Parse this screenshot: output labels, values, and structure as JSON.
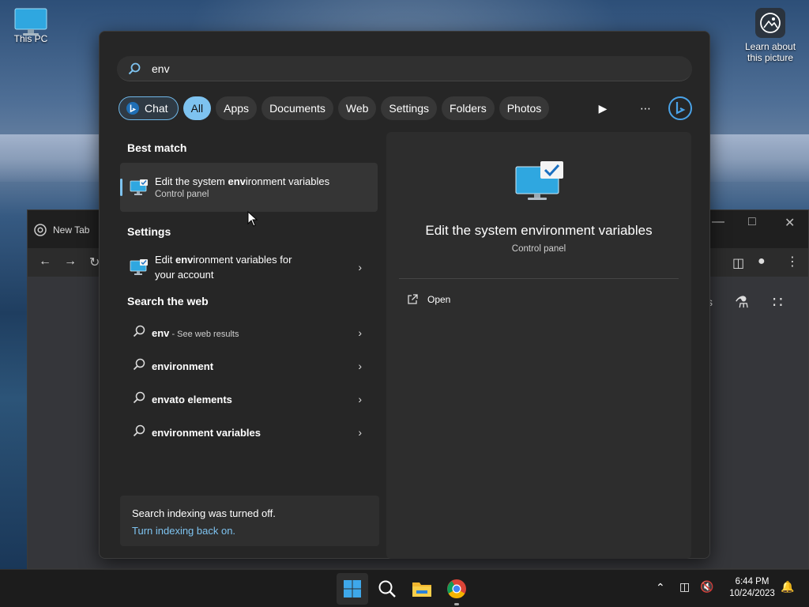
{
  "desktop": {
    "this_pc_label": "This PC",
    "learn_about_label": "Learn about this picture"
  },
  "browser": {
    "tab_title": "New Tab",
    "toolbar_partial_text": "s"
  },
  "search": {
    "query": "env",
    "filters": {
      "chat": "Chat",
      "all": "All",
      "apps": "Apps",
      "documents": "Documents",
      "web": "Web",
      "settings": "Settings",
      "folders": "Folders",
      "photos": "Photos"
    },
    "best_match": {
      "heading": "Best match",
      "title_pre": "Edit the system ",
      "title_bold": "env",
      "title_post": "ironment variables",
      "subtitle": "Control panel"
    },
    "settings_section": {
      "heading": "Settings",
      "title_pre": "Edit ",
      "title_bold": "env",
      "title_post": "ironment variables for",
      "title_line2": "your account"
    },
    "web_section": {
      "heading": "Search the web",
      "items": [
        {
          "bold": "env",
          "rest": "",
          "suffix": " - See web results"
        },
        {
          "bold": "env",
          "rest": "ironment",
          "suffix": ""
        },
        {
          "bold": "env",
          "rest": "ato elements",
          "suffix": ""
        },
        {
          "bold": "env",
          "rest": "ironment variables",
          "suffix": ""
        }
      ]
    },
    "indexing": {
      "message": "Search indexing was turned off.",
      "link": "Turn indexing back on."
    },
    "preview": {
      "title": "Edit the system environment variables",
      "subtitle": "Control panel",
      "open_label": "Open"
    }
  },
  "taskbar": {
    "time": "6:44 PM",
    "date": "10/24/2023"
  },
  "colors": {
    "accent": "#7ec3f0",
    "panel_bg": "#262626",
    "taskbar_bg": "#1c1c1c"
  }
}
